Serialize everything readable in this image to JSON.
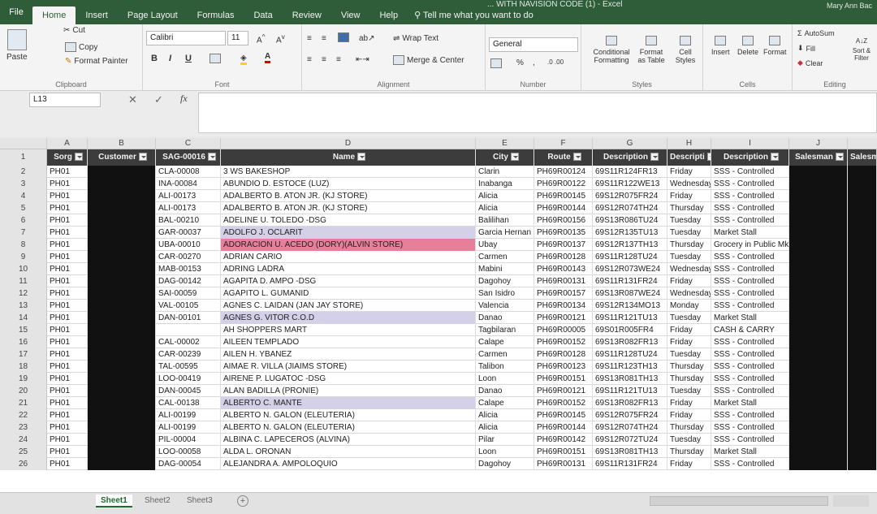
{
  "window": {
    "title": "... WITH NAVISION CODE (1) - Excel",
    "user": "Mary Ann Bac"
  },
  "menu": {
    "file": "File",
    "tabs": [
      "Home",
      "Insert",
      "Page Layout",
      "Formulas",
      "Data",
      "Review",
      "View",
      "Help"
    ],
    "tell_me": "Tell me what you want to do"
  },
  "ribbon": {
    "clipboard": {
      "label": "Clipboard",
      "paste": "Paste",
      "cut": "Cut",
      "copy": "Copy",
      "format_painter": "Format Painter"
    },
    "font": {
      "label": "Font",
      "name": "Calibri",
      "size": "11",
      "bold": "B",
      "italic": "I",
      "underline": "U"
    },
    "alignment": {
      "label": "Alignment",
      "wrap": "Wrap Text",
      "merge": "Merge & Center"
    },
    "number": {
      "label": "Number",
      "format": "General",
      "percent": "%",
      "comma": ","
    },
    "styles": {
      "label": "Styles",
      "conditional": "Conditional Formatting",
      "format_table": "Format as Table",
      "cell_styles": "Cell Styles"
    },
    "cells": {
      "label": "Cells",
      "insert": "Insert",
      "delete": "Delete",
      "format": "Format"
    },
    "editing": {
      "label": "Editing",
      "autosum": "AutoSum",
      "fill": "Fill",
      "clear": "Clear",
      "sort": "Sort & Filter"
    }
  },
  "formula_bar": {
    "name_box": "L13",
    "cancel": "✕",
    "enter": "✓",
    "fx": "fx",
    "value": ""
  },
  "columns": [
    "A",
    "B",
    "C",
    "D",
    "E",
    "F",
    "G",
    "H",
    "I",
    "J"
  ],
  "headers": [
    "Sorg",
    "Customer",
    "SAG-00016",
    "Name",
    "City",
    "Route",
    "Description",
    "Descripti",
    "Description",
    "Salesman",
    "Salesm"
  ],
  "rows": [
    {
      "n": "2",
      "a": "PH01",
      "c": "CLA-00008",
      "d": "3 WS BAKESHOP",
      "e": "Clarin",
      "f": "PH69R00124",
      "g": "69S11R124FR13",
      "h": "Friday",
      "i": "SSS - Controlled"
    },
    {
      "n": "3",
      "a": "PH01",
      "c": "INA-00084",
      "d": "ABUNDIO D. ESTOCE (LUZ)",
      "e": "Inabanga",
      "f": "PH69R00122",
      "g": "69S11R122WE13",
      "h": "Wednesday",
      "i": "SSS - Controlled"
    },
    {
      "n": "4",
      "a": "PH01",
      "c": "ALI-00173",
      "d": "ADALBERTO B. ATON JR. (KJ STORE)",
      "e": "Alicia",
      "f": "PH69R00145",
      "g": "69S12R075FR24",
      "h": "Friday",
      "i": "SSS - Controlled"
    },
    {
      "n": "5",
      "a": "PH01",
      "c": "ALI-00173",
      "d": "ADALBERTO B. ATON JR. (KJ STORE)",
      "e": "Alicia",
      "f": "PH69R00144",
      "g": "69S12R074TH24",
      "h": "Thursday",
      "i": "SSS - Controlled"
    },
    {
      "n": "6",
      "a": "PH01",
      "c": "BAL-00210",
      "d": "ADELINE U. TOLEDO -DSG",
      "e": "Balilihan",
      "f": "PH69R00156",
      "g": "69S13R086TU24",
      "h": "Tuesday",
      "i": "SSS - Controlled"
    },
    {
      "n": "7",
      "a": "PH01",
      "c": "GAR-00037",
      "d": "ADOLFO J. OCLARIT",
      "e": "Garcia Hernan",
      "f": "PH69R00135",
      "g": "69S12R135TU13",
      "h": "Tuesday",
      "i": "Market Stall"
    },
    {
      "n": "8",
      "a": "PH01",
      "c": "UBA-00010",
      "d": "ADORACION U. ACEDO (DORY)(ALVIN STORE)",
      "e": "Ubay",
      "f": "PH69R00137",
      "g": "69S12R137TH13",
      "h": "Thursday",
      "i": "Grocery in Public Mk"
    },
    {
      "n": "9",
      "a": "PH01",
      "c": "CAR-00270",
      "d": "ADRIAN CARIO",
      "e": "Carmen",
      "f": "PH69R00128",
      "g": "69S11R128TU24",
      "h": "Tuesday",
      "i": "SSS - Controlled"
    },
    {
      "n": "10",
      "a": "PH01",
      "c": "MAB-00153",
      "d": "ADRING LADRA",
      "e": "Mabini",
      "f": "PH69R00143",
      "g": "69S12R073WE24",
      "h": "Wednesday",
      "i": "SSS - Controlled"
    },
    {
      "n": "11",
      "a": "PH01",
      "c": "DAG-00142",
      "d": "AGAPITA D. AMPO -DSG",
      "e": "Dagohoy",
      "f": "PH69R00131",
      "g": "69S11R131FR24",
      "h": "Friday",
      "i": "SSS - Controlled"
    },
    {
      "n": "12",
      "a": "PH01",
      "c": "SAI-00059",
      "d": "AGAPITO L. GUMANID",
      "e": "San Isidro",
      "f": "PH69R00157",
      "g": "69S13R087WE24",
      "h": "Wednesday",
      "i": "SSS - Controlled"
    },
    {
      "n": "13",
      "a": "PH01",
      "c": "VAL-00105",
      "d": "AGNES C. LAIDAN (JAN JAY STORE)",
      "e": "Valencia",
      "f": "PH69R00134",
      "g": "69S12R134MO13",
      "h": "Monday",
      "i": "SSS - Controlled"
    },
    {
      "n": "14",
      "a": "PH01",
      "c": "DAN-00101",
      "d": "AGNES G. VITOR C.O.D",
      "e": "Danao",
      "f": "PH69R00121",
      "g": "69S11R121TU13",
      "h": "Tuesday",
      "i": "Market Stall"
    },
    {
      "n": "15",
      "a": "PH01",
      "c": "",
      "d": "AH SHOPPERS MART",
      "e": "Tagbilaran",
      "f": "PH69R00005",
      "g": "69S01R005FR4",
      "h": "Friday",
      "i": "CASH & CARRY"
    },
    {
      "n": "16",
      "a": "PH01",
      "c": "CAL-00002",
      "d": "AILEEN TEMPLADO",
      "e": "Calape",
      "f": "PH69R00152",
      "g": "69S13R082FR13",
      "h": "Friday",
      "i": "SSS - Controlled"
    },
    {
      "n": "17",
      "a": "PH01",
      "c": "CAR-00239",
      "d": "AILEN H. YBANEZ",
      "e": "Carmen",
      "f": "PH69R00128",
      "g": "69S11R128TU24",
      "h": "Tuesday",
      "i": "SSS - Controlled"
    },
    {
      "n": "18",
      "a": "PH01",
      "c": "TAL-00595",
      "d": "AIMAE R. VILLA (JIAIMS STORE)",
      "e": "Talibon",
      "f": "PH69R00123",
      "g": "69S11R123TH13",
      "h": "Thursday",
      "i": "SSS - Controlled"
    },
    {
      "n": "19",
      "a": "PH01",
      "c": "LOO-00419",
      "d": "AIRENE P. LUGATOC -DSG",
      "e": "Loon",
      "f": "PH69R00151",
      "g": "69S13R081TH13",
      "h": "Thursday",
      "i": "SSS - Controlled"
    },
    {
      "n": "20",
      "a": "PH01",
      "c": "DAN-00045",
      "d": "ALAN BADILLA (PRONIE)",
      "e": "Danao",
      "f": "PH69R00121",
      "g": "69S11R121TU13",
      "h": "Tuesday",
      "i": "SSS - Controlled"
    },
    {
      "n": "21",
      "a": "PH01",
      "c": "CAL-00138",
      "d": "ALBERTO C. MANTE",
      "e": "Calape",
      "f": "PH69R00152",
      "g": "69S13R082FR13",
      "h": "Friday",
      "i": "Market Stall"
    },
    {
      "n": "22",
      "a": "PH01",
      "c": "ALI-00199",
      "d": "ALBERTO N. GALON (ELEUTERIA)",
      "e": "Alicia",
      "f": "PH69R00145",
      "g": "69S12R075FR24",
      "h": "Friday",
      "i": "SSS - Controlled"
    },
    {
      "n": "23",
      "a": "PH01",
      "c": "ALI-00199",
      "d": "ALBERTO N. GALON (ELEUTERIA)",
      "e": "Alicia",
      "f": "PH69R00144",
      "g": "69S12R074TH24",
      "h": "Thursday",
      "i": "SSS - Controlled"
    },
    {
      "n": "24",
      "a": "PH01",
      "c": "PIL-00004",
      "d": "ALBINA C. LAPECEROS (ALVINA)",
      "e": "Pilar",
      "f": "PH69R00142",
      "g": "69S12R072TU24",
      "h": "Tuesday",
      "i": "SSS - Controlled"
    },
    {
      "n": "25",
      "a": "PH01",
      "c": "LOO-00058",
      "d": "ALDA L. ORONAN",
      "e": "Loon",
      "f": "PH69R00151",
      "g": "69S13R081TH13",
      "h": "Thursday",
      "i": "Market Stall"
    },
    {
      "n": "26",
      "a": "PH01",
      "c": "DAG-00054",
      "d": "ALEJANDRA A. AMPOLOQUIO",
      "e": "Dagohoy",
      "f": "PH69R00131",
      "g": "69S11R131FR24",
      "h": "Friday",
      "i": "SSS - Controlled"
    }
  ],
  "highlight": {
    "pink_row": "8",
    "lavender_rows": [
      "7",
      "14",
      "21"
    ],
    "pink": "#e57f9a",
    "lavender": "#d3d0e8"
  },
  "sheets": [
    "Sheet1",
    "Sheet2",
    "Sheet3"
  ],
  "add_sheet": "+",
  "colors": {
    "title_bar": "#2f5d3a",
    "header_fill": "#3c3c3c",
    "accent": "#1f6a2e"
  }
}
